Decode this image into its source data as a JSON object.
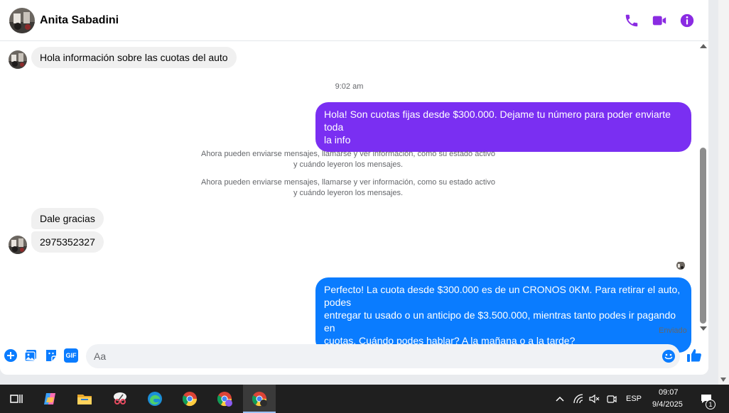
{
  "contact": {
    "name": "Anita Sabadini"
  },
  "colors": {
    "accent": "#8a2be2",
    "outgoing_purple": "#7a2ff2",
    "outgoing_blue": "#0a7cff",
    "incoming": "#f0f0f0"
  },
  "header_icons": [
    "phone-icon",
    "video-call-icon",
    "info-icon"
  ],
  "messages": {
    "m1": "Hola información sobre las cuotas del auto",
    "ts1": "9:02 am",
    "m2_line1": "Hola! Son cuotas fijas desde $300.000. Dejame tu número para poder enviarte toda",
    "m2_line2": "la info",
    "sys1_line1": "Ahora pueden enviarse mensajes, llamarse y ver información, como su estado activo",
    "sys1_line2": "y cuándo leyeron los mensajes.",
    "sys2_line1": "Ahora pueden enviarse mensajes, llamarse y ver información, como su estado activo",
    "sys2_line2": "y cuándo leyeron los mensajes.",
    "m3": "Dale gracias",
    "m4": "2975352327",
    "m5_line1": "Perfecto! La cuota desde $300.000 es de un CRONOS 0KM. Para retirar el auto, podes",
    "m5_line2": "entregar tu usado o un anticipo de $3.500.000, mientras tanto podes ir pagando en",
    "m5_line3": "cuotas. Cuándo podes hablar? A la mañana o a la tarde?",
    "sent": "Enviado"
  },
  "composer": {
    "placeholder": "Aa",
    "icons": [
      "plus-icon",
      "gallery-icon",
      "sticker-icon",
      "gif-icon",
      "emoji-icon",
      "like-icon"
    ],
    "gif": "GIF"
  },
  "taskbar": {
    "apps": [
      "task-view-icon",
      "copilot-icon",
      "file-explorer-icon",
      "snipping-tool-icon",
      "edge-icon",
      "chrome-icon",
      "chrome-profile-icon",
      "chrome-profile-active-icon"
    ],
    "lang": "ESP",
    "time": "09:07",
    "date": "9/4/2025",
    "notifications": "1"
  }
}
